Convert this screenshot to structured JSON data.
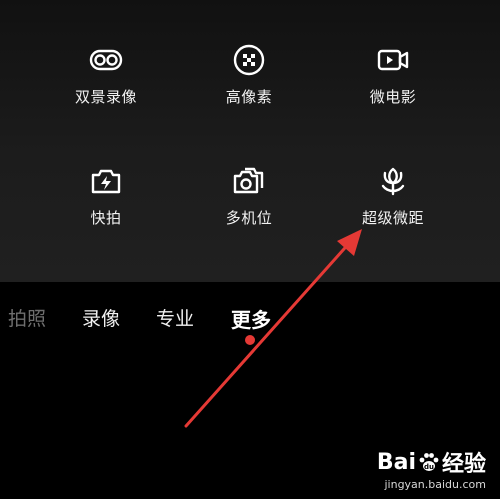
{
  "modes": [
    {
      "label": "双景录像",
      "icon": "dual-view-icon"
    },
    {
      "label": "高像素",
      "icon": "high-resolution-icon"
    },
    {
      "label": "微电影",
      "icon": "video-icon"
    },
    {
      "label": "快拍",
      "icon": "quick-shot-icon"
    },
    {
      "label": "多机位",
      "icon": "multi-camera-icon"
    },
    {
      "label": "超级微距",
      "icon": "macro-flower-icon"
    }
  ],
  "tabs": [
    {
      "label": "拍照",
      "state": "dimmed"
    },
    {
      "label": "录像",
      "state": "normal"
    },
    {
      "label": "专业",
      "state": "normal"
    },
    {
      "label": "更多",
      "state": "active"
    }
  ],
  "annotation": {
    "color": "#e53935",
    "icon": "red-arrow"
  },
  "watermark": {
    "brand_left": "Bai",
    "brand_right": "经验",
    "url": "jingyan.baidu.com"
  }
}
